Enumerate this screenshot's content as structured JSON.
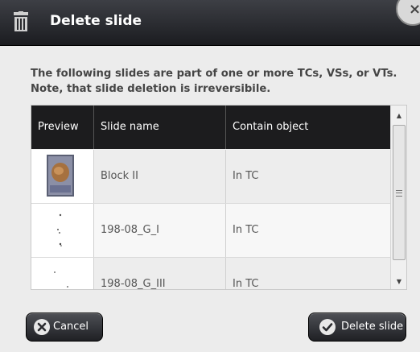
{
  "dialog": {
    "title": "Delete slide",
    "close_label": "×",
    "message": "The following slides are part of one or more TCs, VSs, or VTs. Note, that slide deletion is irreversibile."
  },
  "table": {
    "headers": {
      "preview": "Preview",
      "name": "Slide name",
      "contain": "Contain object"
    },
    "rows": [
      {
        "name": "Block II",
        "contain": "In TC"
      },
      {
        "name": "198-08_G_I",
        "contain": "In TC"
      },
      {
        "name": "198-08_G_III",
        "contain": "In TC"
      }
    ]
  },
  "buttons": {
    "cancel": "Cancel",
    "delete": "Delete slide"
  }
}
